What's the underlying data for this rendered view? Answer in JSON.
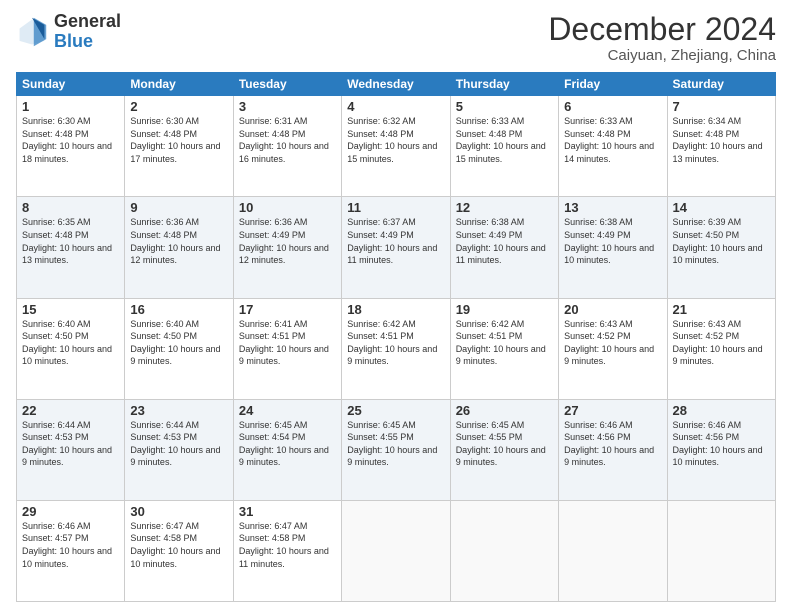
{
  "logo": {
    "general": "General",
    "blue": "Blue"
  },
  "title": "December 2024",
  "location": "Caiyuan, Zhejiang, China",
  "days_of_week": [
    "Sunday",
    "Monday",
    "Tuesday",
    "Wednesday",
    "Thursday",
    "Friday",
    "Saturday"
  ],
  "weeks": [
    [
      {
        "day": "1",
        "sunrise": "6:30 AM",
        "sunset": "4:48 PM",
        "daylight": "10 hours and 18 minutes."
      },
      {
        "day": "2",
        "sunrise": "6:30 AM",
        "sunset": "4:48 PM",
        "daylight": "10 hours and 17 minutes."
      },
      {
        "day": "3",
        "sunrise": "6:31 AM",
        "sunset": "4:48 PM",
        "daylight": "10 hours and 16 minutes."
      },
      {
        "day": "4",
        "sunrise": "6:32 AM",
        "sunset": "4:48 PM",
        "daylight": "10 hours and 15 minutes."
      },
      {
        "day": "5",
        "sunrise": "6:33 AM",
        "sunset": "4:48 PM",
        "daylight": "10 hours and 15 minutes."
      },
      {
        "day": "6",
        "sunrise": "6:33 AM",
        "sunset": "4:48 PM",
        "daylight": "10 hours and 14 minutes."
      },
      {
        "day": "7",
        "sunrise": "6:34 AM",
        "sunset": "4:48 PM",
        "daylight": "10 hours and 13 minutes."
      }
    ],
    [
      {
        "day": "8",
        "sunrise": "6:35 AM",
        "sunset": "4:48 PM",
        "daylight": "10 hours and 13 minutes."
      },
      {
        "day": "9",
        "sunrise": "6:36 AM",
        "sunset": "4:48 PM",
        "daylight": "10 hours and 12 minutes."
      },
      {
        "day": "10",
        "sunrise": "6:36 AM",
        "sunset": "4:49 PM",
        "daylight": "10 hours and 12 minutes."
      },
      {
        "day": "11",
        "sunrise": "6:37 AM",
        "sunset": "4:49 PM",
        "daylight": "10 hours and 11 minutes."
      },
      {
        "day": "12",
        "sunrise": "6:38 AM",
        "sunset": "4:49 PM",
        "daylight": "10 hours and 11 minutes."
      },
      {
        "day": "13",
        "sunrise": "6:38 AM",
        "sunset": "4:49 PM",
        "daylight": "10 hours and 10 minutes."
      },
      {
        "day": "14",
        "sunrise": "6:39 AM",
        "sunset": "4:50 PM",
        "daylight": "10 hours and 10 minutes."
      }
    ],
    [
      {
        "day": "15",
        "sunrise": "6:40 AM",
        "sunset": "4:50 PM",
        "daylight": "10 hours and 10 minutes."
      },
      {
        "day": "16",
        "sunrise": "6:40 AM",
        "sunset": "4:50 PM",
        "daylight": "10 hours and 9 minutes."
      },
      {
        "day": "17",
        "sunrise": "6:41 AM",
        "sunset": "4:51 PM",
        "daylight": "10 hours and 9 minutes."
      },
      {
        "day": "18",
        "sunrise": "6:42 AM",
        "sunset": "4:51 PM",
        "daylight": "10 hours and 9 minutes."
      },
      {
        "day": "19",
        "sunrise": "6:42 AM",
        "sunset": "4:51 PM",
        "daylight": "10 hours and 9 minutes."
      },
      {
        "day": "20",
        "sunrise": "6:43 AM",
        "sunset": "4:52 PM",
        "daylight": "10 hours and 9 minutes."
      },
      {
        "day": "21",
        "sunrise": "6:43 AM",
        "sunset": "4:52 PM",
        "daylight": "10 hours and 9 minutes."
      }
    ],
    [
      {
        "day": "22",
        "sunrise": "6:44 AM",
        "sunset": "4:53 PM",
        "daylight": "10 hours and 9 minutes."
      },
      {
        "day": "23",
        "sunrise": "6:44 AM",
        "sunset": "4:53 PM",
        "daylight": "10 hours and 9 minutes."
      },
      {
        "day": "24",
        "sunrise": "6:45 AM",
        "sunset": "4:54 PM",
        "daylight": "10 hours and 9 minutes."
      },
      {
        "day": "25",
        "sunrise": "6:45 AM",
        "sunset": "4:55 PM",
        "daylight": "10 hours and 9 minutes."
      },
      {
        "day": "26",
        "sunrise": "6:45 AM",
        "sunset": "4:55 PM",
        "daylight": "10 hours and 9 minutes."
      },
      {
        "day": "27",
        "sunrise": "6:46 AM",
        "sunset": "4:56 PM",
        "daylight": "10 hours and 9 minutes."
      },
      {
        "day": "28",
        "sunrise": "6:46 AM",
        "sunset": "4:56 PM",
        "daylight": "10 hours and 10 minutes."
      }
    ],
    [
      {
        "day": "29",
        "sunrise": "6:46 AM",
        "sunset": "4:57 PM",
        "daylight": "10 hours and 10 minutes."
      },
      {
        "day": "30",
        "sunrise": "6:47 AM",
        "sunset": "4:58 PM",
        "daylight": "10 hours and 10 minutes."
      },
      {
        "day": "31",
        "sunrise": "6:47 AM",
        "sunset": "4:58 PM",
        "daylight": "10 hours and 11 minutes."
      },
      null,
      null,
      null,
      null
    ]
  ]
}
